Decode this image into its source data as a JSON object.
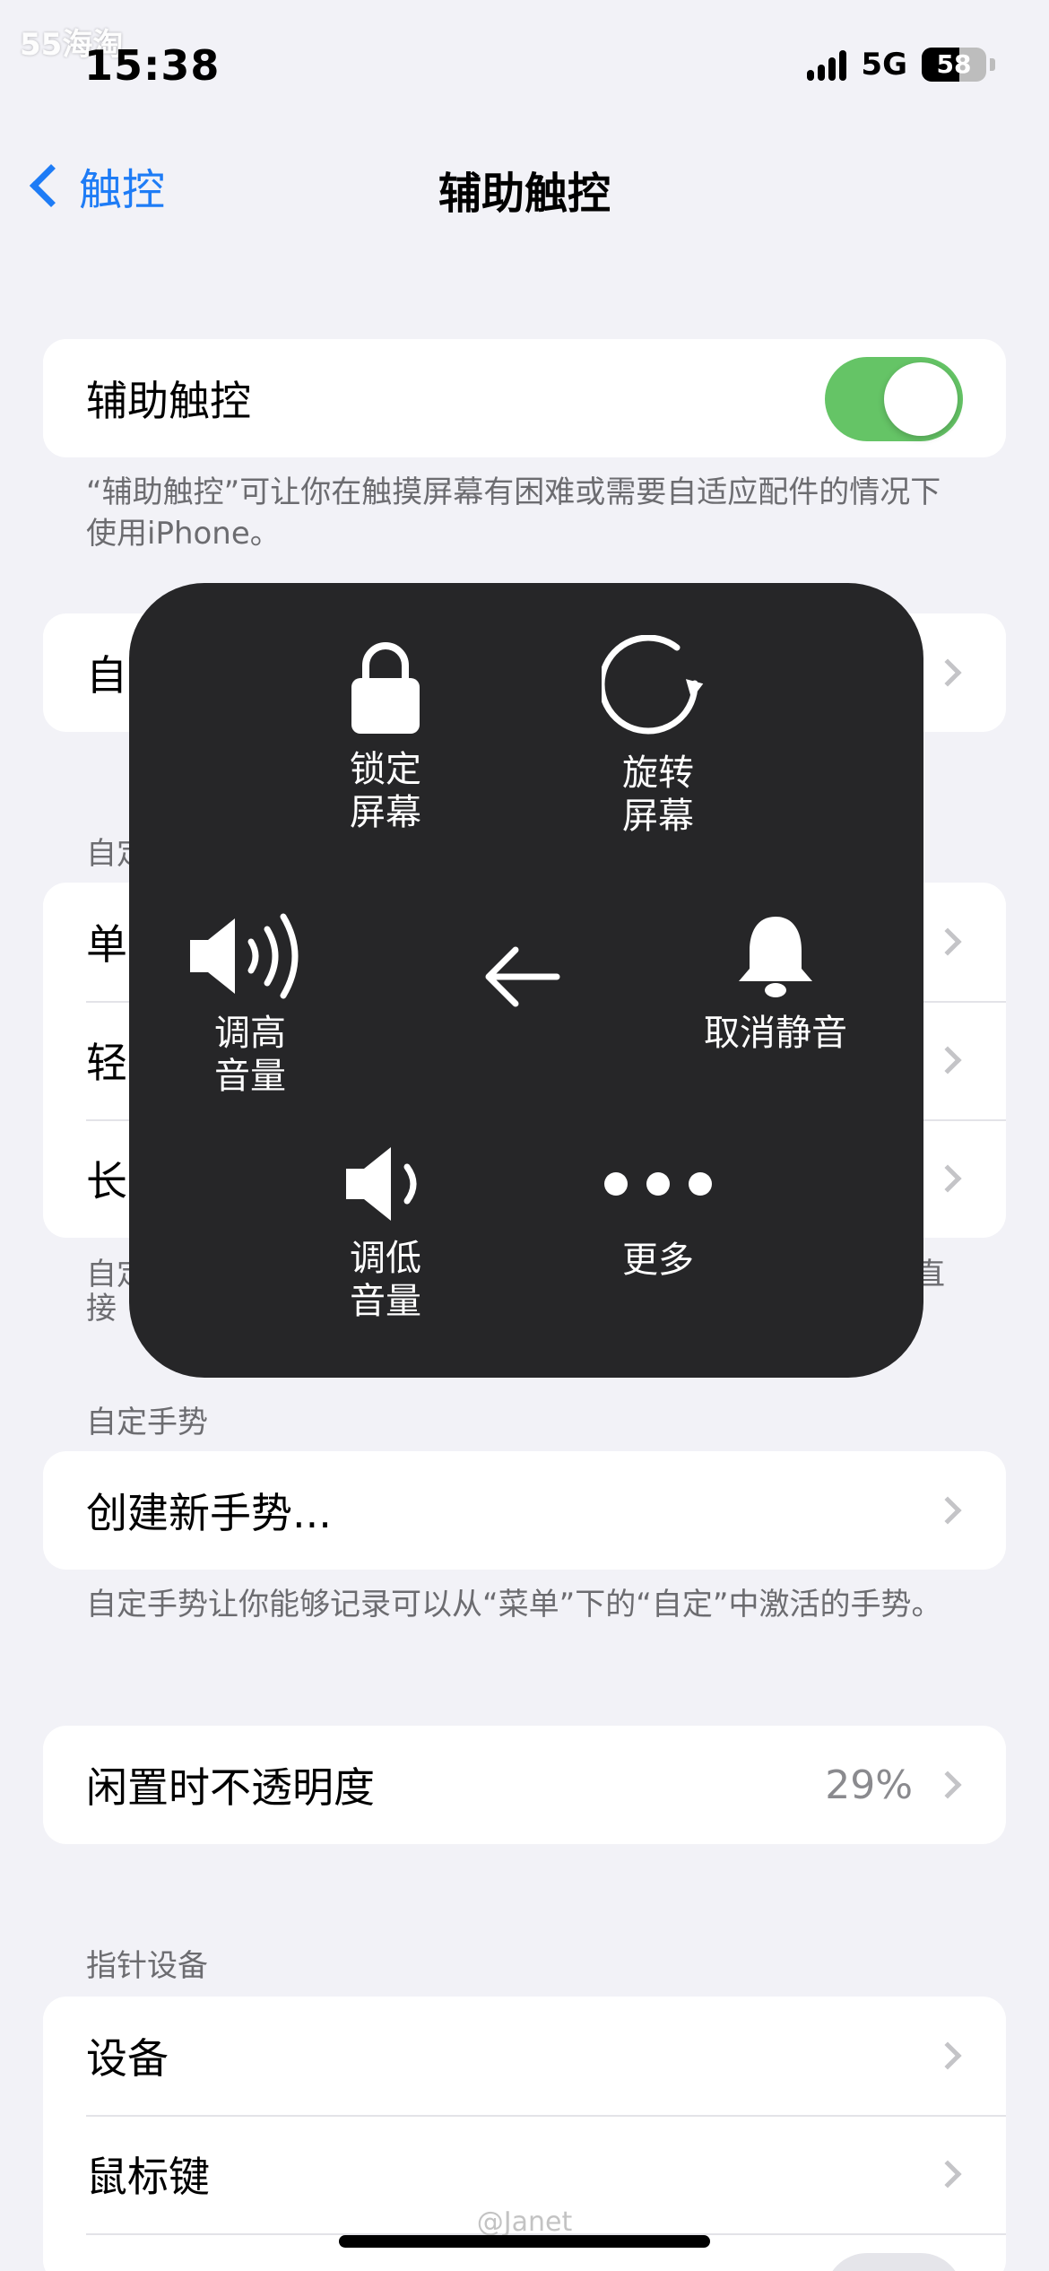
{
  "watermark": {
    "top": "55海淘",
    "bottom": "@Janet"
  },
  "status_bar": {
    "time": "15:38",
    "network": "5G",
    "battery": "58"
  },
  "nav": {
    "back_label": "触控",
    "title": "辅助触控"
  },
  "main_toggle": {
    "label": "辅助触控",
    "state": "on",
    "footer": "“辅助触控”可让你在触摸屏幕有困难或需要自适应配件的情况下使用iPhone。"
  },
  "menu_card_partial": {
    "label": "自"
  },
  "custom_actions": {
    "header": "自定",
    "rows": [
      {
        "label": "单"
      },
      {
        "label": "轻"
      },
      {
        "label": "长"
      }
    ],
    "footer_left": "自定",
    "footer_left_2": "接",
    "footer_right": "直"
  },
  "gestures": {
    "header": "自定手势",
    "create_label": "创建新手势...",
    "footer": "自定手势让你能够记录可以从“菜单”下的“自定”中激活的手势。"
  },
  "idle_opacity": {
    "label": "闲置时不透明度",
    "value": "29%"
  },
  "pointer": {
    "header": "指针设备",
    "devices_label": "设备",
    "mouse_keys_label": "鼠标键"
  },
  "menu": {
    "lock": {
      "line1": "锁定",
      "line2": "屏幕"
    },
    "rotate": {
      "line1": "旋转",
      "line2": "屏幕"
    },
    "volume_up": {
      "line1": "调高",
      "line2": "音量"
    },
    "unmute": {
      "label": "取消静音"
    },
    "volume_down": {
      "line1": "调低",
      "line2": "音量"
    },
    "more": {
      "label": "更多"
    }
  },
  "colors": {
    "accent": "#1e7cf6",
    "toggle_on": "#65c466",
    "menu_bg": "#262628",
    "background": "#f2f2f7"
  }
}
